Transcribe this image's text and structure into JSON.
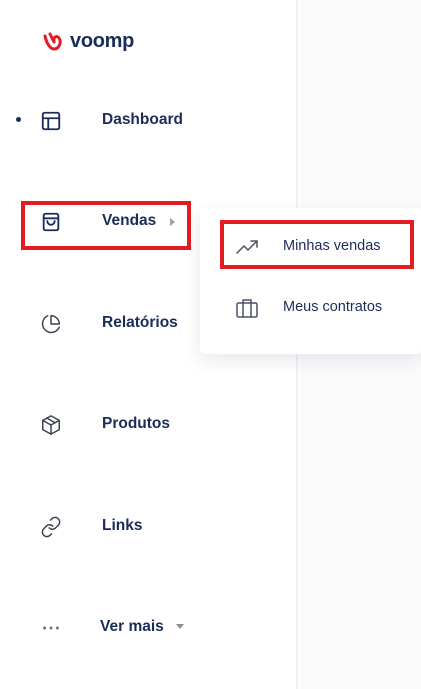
{
  "app": {
    "logo_text": "voomp",
    "brand_color": "#e31b23",
    "text_color": "#1a2d5a"
  },
  "sidebar": {
    "items": [
      {
        "label": "Dashboard",
        "icon": "layout-icon",
        "active": true
      },
      {
        "label": "Vendas",
        "icon": "shopping-bag-icon",
        "has_submenu": true
      },
      {
        "label": "Relatórios",
        "icon": "pie-chart-icon"
      },
      {
        "label": "Produtos",
        "icon": "package-icon"
      },
      {
        "label": "Links",
        "icon": "link-icon"
      },
      {
        "label": "Ver mais",
        "icon": "more-horizontal-icon",
        "has_dropdown": true
      }
    ]
  },
  "submenu": {
    "items": [
      {
        "label": "Minhas vendas",
        "icon": "trending-up-icon"
      },
      {
        "label": "Meus contratos",
        "icon": "briefcase-icon"
      }
    ]
  }
}
